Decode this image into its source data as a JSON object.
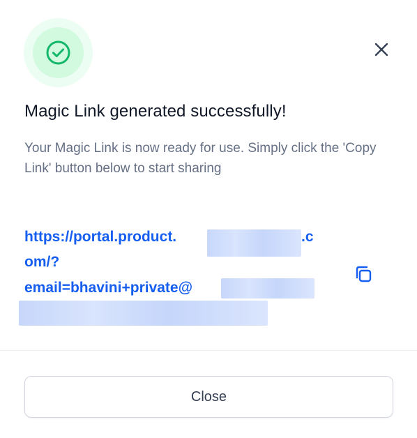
{
  "modal": {
    "title": "Magic Link generated successfully!",
    "description": "Your Magic Link is now ready for use. Simply click the 'Copy Link' button below to start sharing",
    "link": {
      "line1_prefix": "https://portal.product.",
      "line1_suffix": ".c",
      "line2": "om/?",
      "line3_prefix": "email=bhavini+private@"
    },
    "close_button_label": "Close"
  },
  "icons": {
    "status": "check-circle-icon",
    "close": "close-icon",
    "copy": "copy-icon"
  },
  "colors": {
    "success": "#12b76a",
    "link": "#155eef",
    "title": "#101828",
    "text_muted": "#667085"
  }
}
